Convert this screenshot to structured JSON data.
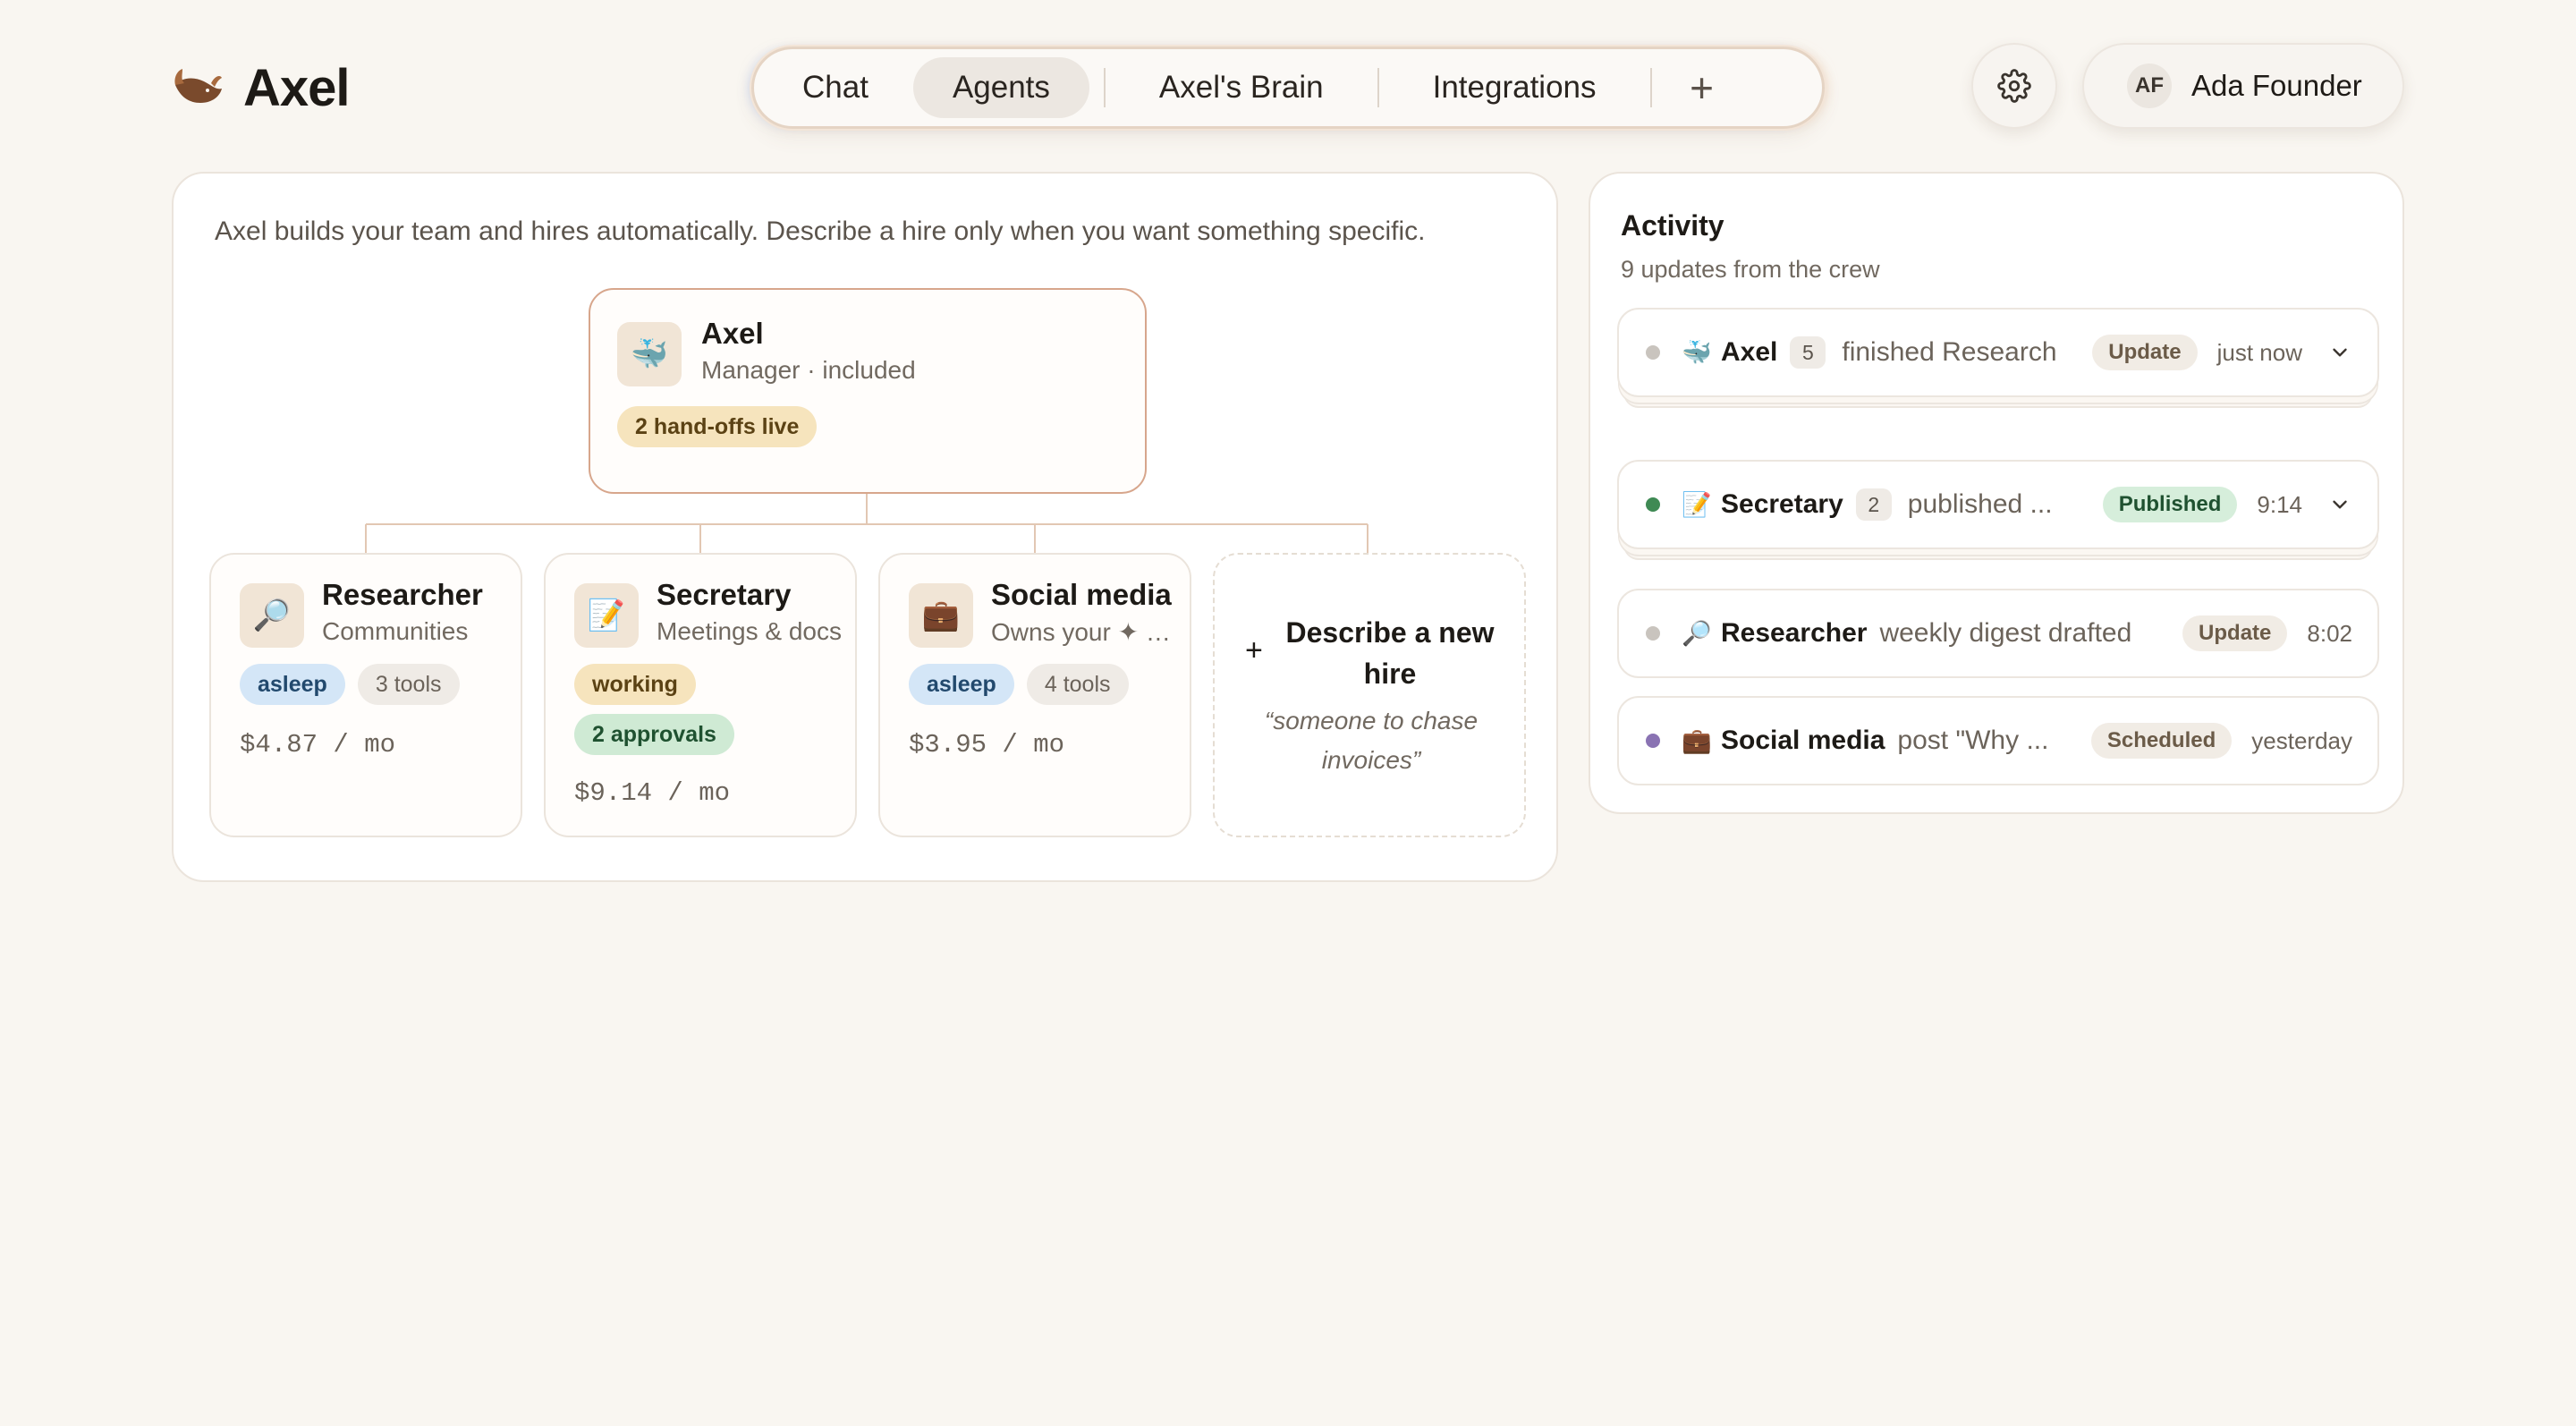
{
  "app": {
    "name": "Axel"
  },
  "nav": {
    "tabs": [
      {
        "label": "Chat",
        "active": false
      },
      {
        "label": "Agents",
        "active": true
      },
      {
        "label": "Axel's Brain",
        "active": false
      },
      {
        "label": "Integrations",
        "active": false
      }
    ],
    "add_label": "+"
  },
  "user": {
    "initials": "AF",
    "name": "Ada Founder"
  },
  "team": {
    "intro": "Axel builds your team and hires automatically. Describe a hire only when you want something specific.",
    "manager": {
      "icon": "🐳",
      "name": "Axel",
      "subtitle": "Manager · included",
      "badge": "2 hand-offs live"
    },
    "agents": [
      {
        "icon": "🔎",
        "name": "Researcher",
        "subtitle": "Communities",
        "status": "asleep",
        "tools": "3 tools",
        "approvals": "",
        "cost": "$4.87 / mo"
      },
      {
        "icon": "📝",
        "name": "Secretary",
        "subtitle": "Meetings & docs",
        "status": "working",
        "tools": "",
        "approvals": "2 approvals",
        "cost": "$9.14 / mo"
      },
      {
        "icon": "💼",
        "name": "Social media",
        "subtitle": "Owns your ✦ brand",
        "status": "asleep",
        "tools": "4 tools",
        "approvals": "",
        "cost": "$3.95 / mo"
      }
    ],
    "new_hire": {
      "plus": "+",
      "title": "Describe a new hire",
      "example": "“someone to chase invoices”"
    }
  },
  "activity": {
    "title": "Activity",
    "subtitle": "9 updates from the crew",
    "items": [
      {
        "dot_color": "#c9c4be",
        "icon": "🐳",
        "who": "Axel",
        "count": "5",
        "what": "finished Research",
        "status": "Update",
        "time": "just now"
      },
      {
        "dot_color": "#3f8a54",
        "icon": "📝",
        "who": "Secretary",
        "count": "2",
        "what": "published ...",
        "status": "Published",
        "time": "9:14"
      },
      {
        "dot_color": "#c9c4be",
        "icon": "🔎",
        "who": "Researcher",
        "count": "",
        "what": "weekly digest drafted",
        "status": "Update",
        "time": "8:02"
      },
      {
        "dot_color": "#8a73b3",
        "icon": "💼",
        "who": "Social media",
        "count": "",
        "what": "post \"Why ...",
        "status": "Scheduled",
        "time": "yesterday"
      }
    ]
  },
  "colors": {
    "background": "#f9f6f1",
    "manager_border": "#d7a68c",
    "tree_line": "#e2c7b3"
  }
}
